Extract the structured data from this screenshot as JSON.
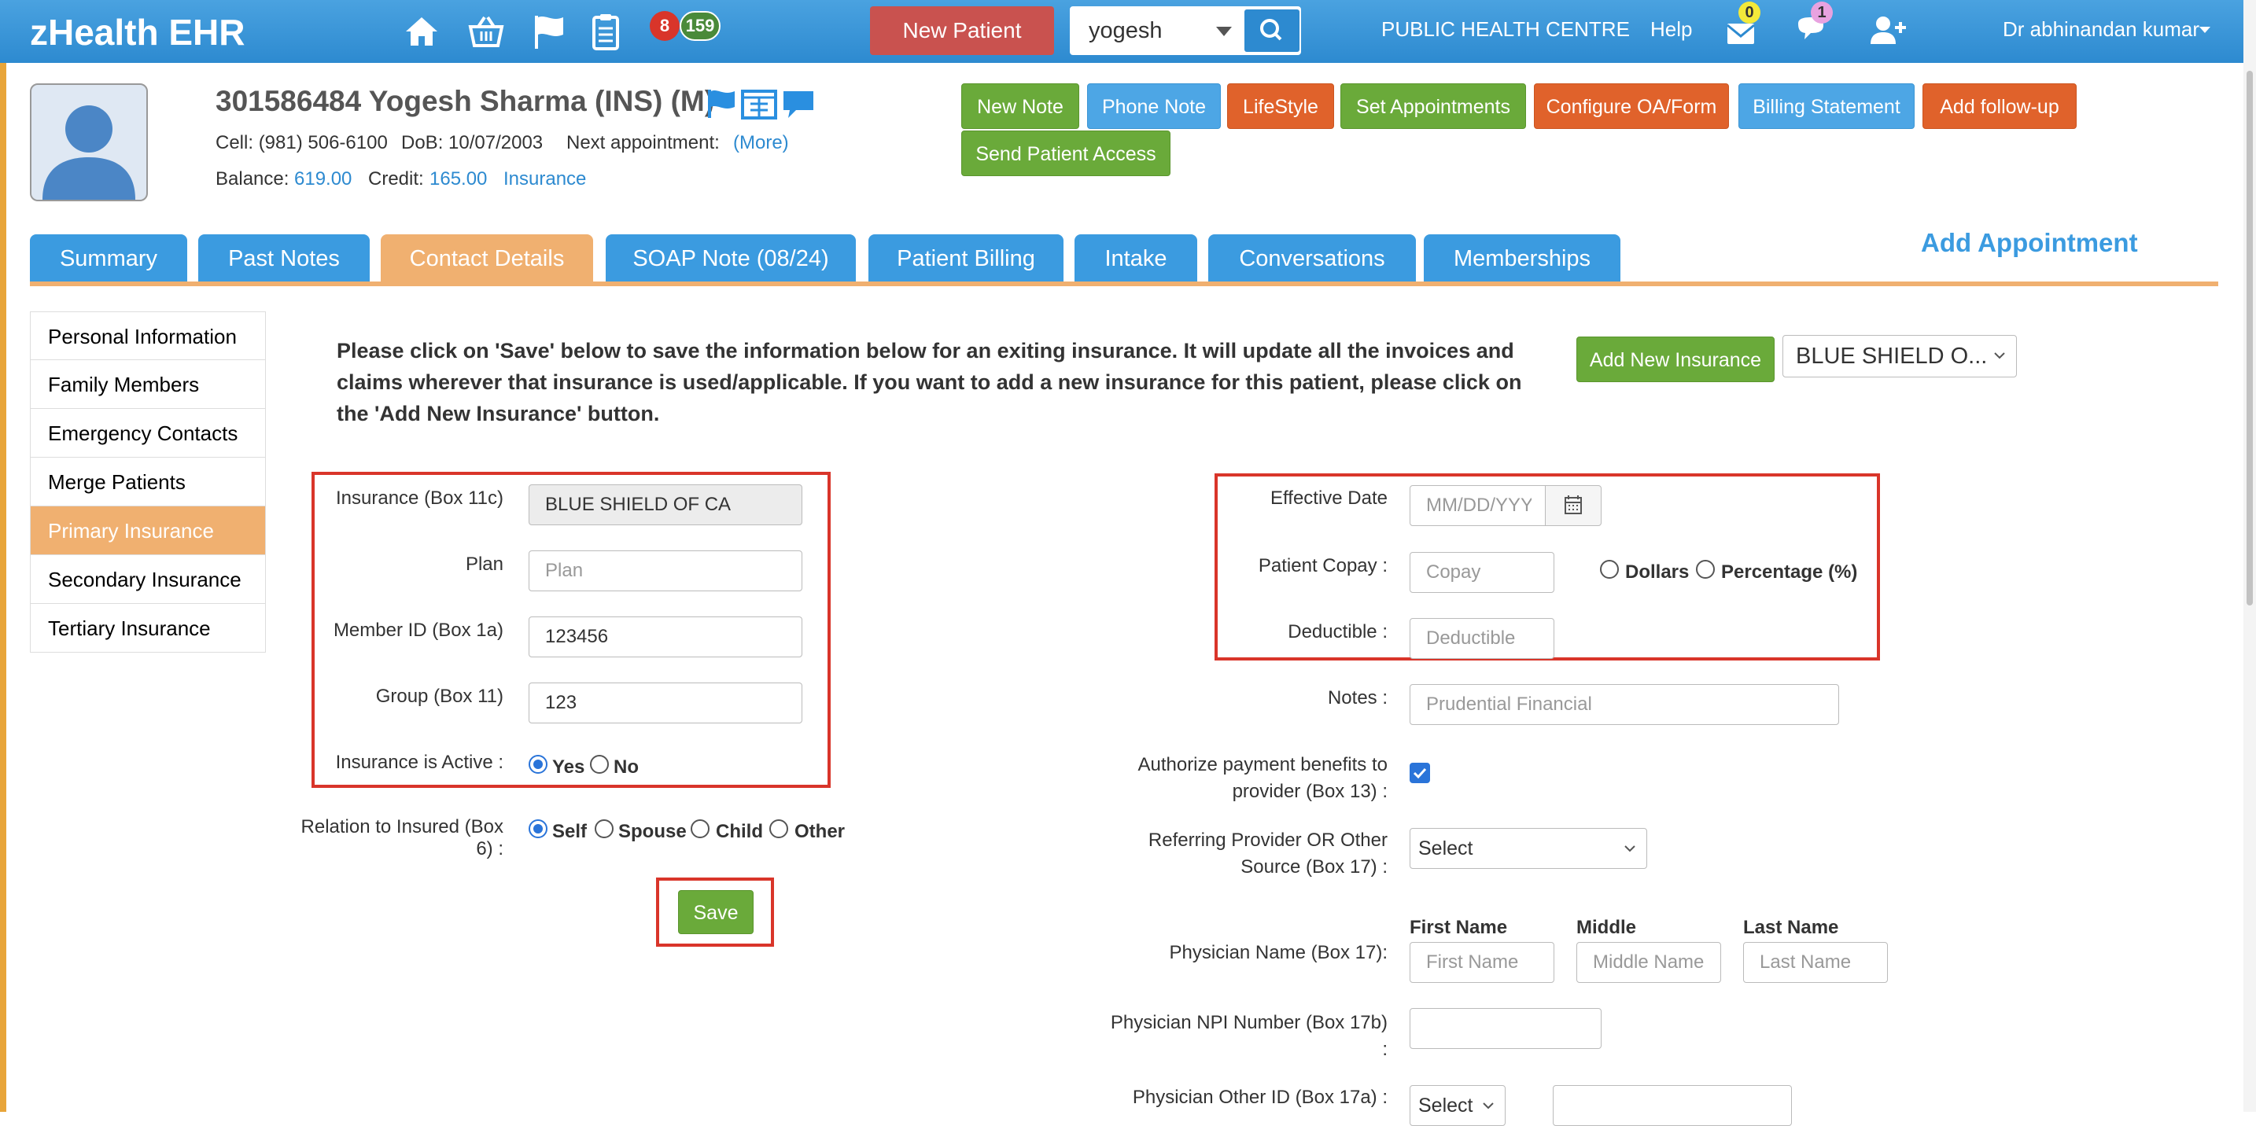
{
  "app": {
    "title": "zHealth EHR"
  },
  "topbar": {
    "badge_red": "8",
    "badge_green": "159",
    "new_patient": "New Patient",
    "search_value": "yogesh",
    "clinic": "PUBLIC HEALTH CENTRE",
    "help": "Help",
    "mail_count": "0",
    "chat_count": "1",
    "user": "Dr abhinandan kumar"
  },
  "patient": {
    "title": "301586484 Yogesh Sharma  (INS) (M)",
    "cell_label": "Cell:",
    "cell": "(981) 506-6100",
    "dob_label": "DoB:",
    "dob": "10/07/2003",
    "next_appt_label": "Next appointment:",
    "more": "(More)",
    "balance_label": "Balance:",
    "balance": "619.00",
    "credit_label": "Credit:",
    "credit": "165.00",
    "insurance_link": "Insurance"
  },
  "actions": {
    "new_note": "New Note",
    "phone_note": "Phone Note",
    "lifestyle": "LifeStyle",
    "set_appointments": "Set Appointments",
    "configure": "Configure OA/Form",
    "billing": "Billing Statement",
    "followup": "Add follow-up",
    "send_access": "Send Patient Access"
  },
  "tabs": [
    "Summary",
    "Past Notes",
    "Contact Details",
    "SOAP Note (08/24)",
    "Patient Billing",
    "Intake",
    "Conversations",
    "Memberships"
  ],
  "add_appointment": "Add Appointment",
  "sidebar": [
    "Personal Information",
    "Family Members",
    "Emergency Contacts",
    "Merge Patients",
    "Primary Insurance",
    "Secondary Insurance",
    "Tertiary Insurance"
  ],
  "form": {
    "note": "Please click on 'Save' below to save the information below for an exiting insurance. It will update all the invoices and claims wherever that insurance is used/applicable. If you want to add a new insurance for this patient, please click on the 'Add New Insurance' button.",
    "add_new_insurance": "Add New Insurance",
    "insurance_select": "BLUE SHIELD O...",
    "insurance_label": "Insurance (Box 11c)",
    "insurance_value": "BLUE SHIELD OF CA",
    "plan_label": "Plan",
    "plan_placeholder": "Plan",
    "member_label": "Member ID (Box 1a)",
    "member_value": "123456",
    "group_label": "Group (Box 11)",
    "group_value": "123",
    "active_label": "Insurance is Active :",
    "yes": "Yes",
    "no": "No",
    "relation_label_1": "Relation to Insured (Box",
    "relation_label_2": "6) :",
    "self": "Self",
    "spouse": "Spouse",
    "child": "Child",
    "other": "Other",
    "save": "Save",
    "effective_label": "Effective Date",
    "effective_placeholder": "MM/DD/YYYY",
    "copay_label": "Patient Copay :",
    "copay_placeholder": "Copay",
    "dollars": "Dollars",
    "percentage": "Percentage (%)",
    "deductible_label": "Deductible :",
    "deductible_placeholder": "Deductible",
    "notes_label": "Notes :",
    "notes_placeholder": "Prudential Financial",
    "authorize_label_1": "Authorize payment benefits to",
    "authorize_label_2": "provider (Box 13) :",
    "referring_label_1": "Referring Provider OR Other",
    "referring_label_2": "Source (Box 17) :",
    "referring_select": "Select",
    "first_name_head": "First Name",
    "middle_head": "Middle",
    "last_name_head": "Last Name",
    "physician_label": "Physician Name (Box 17):",
    "first_placeholder": "First Name",
    "middle_placeholder": "Middle Name",
    "last_placeholder": "Last Name",
    "npi_label_1": "Physician NPI Number (Box 17b)",
    "npi_label_2": ":",
    "other_id_label": "Physician Other ID (Box 17a) :",
    "other_id_select": "Select"
  },
  "colors": {
    "topbar": "#2d8ad0",
    "tab_blue": "#3b9be0",
    "tab_active": "#f0b070",
    "green": "#6aaa3a",
    "orange": "#e0622b",
    "red_box": "#d9352a"
  }
}
